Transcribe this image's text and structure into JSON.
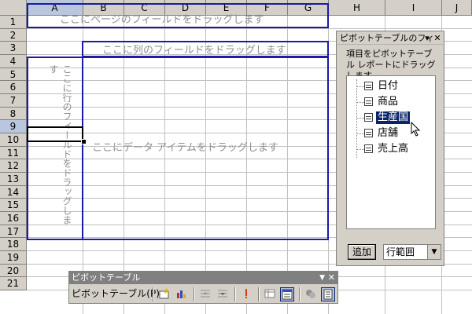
{
  "spreadsheet": {
    "columns": [
      "A",
      "B",
      "C",
      "D",
      "E",
      "F",
      "G",
      "H",
      "I",
      "J"
    ],
    "rows": [
      "1",
      "2",
      "3",
      "4",
      "5",
      "6",
      "7",
      "8",
      "9",
      "10",
      "11",
      "12",
      "13",
      "14",
      "15",
      "16",
      "17",
      "18",
      "19",
      "20",
      "21"
    ],
    "selected_column": "A",
    "selected_row": "9"
  },
  "pivot_regions": {
    "page_drop": "ここにページのフィールドをドラッグします",
    "column_drop": "ここに列のフィールドをドラッグします",
    "row_drop": "ここに行のフィールドをドラッグします",
    "data_drop": "ここにデータ アイテムをドラッグします"
  },
  "field_panel": {
    "title": "ピボットテーブルのフィ",
    "description": "項目をピボットテーブル レポートにドラッグします",
    "fields": [
      {
        "label": "日付"
      },
      {
        "label": "商品"
      },
      {
        "label": "生産国",
        "selected": true
      },
      {
        "label": "店舗"
      },
      {
        "label": "売上高"
      }
    ],
    "add_button": "追加",
    "area_select": "行範囲"
  },
  "pivot_toolbar": {
    "title": "ピボットテーブル",
    "menu_label": "ピボットテーブル(P)",
    "icons": [
      "format-report-icon",
      "chart-wizard-icon",
      "hide-detail-icon",
      "show-detail-icon",
      "refresh-icon",
      "field-settings-icon",
      "field-list-icon",
      "hide-items-icon",
      "show-field-list-icon"
    ]
  },
  "colors": {
    "region_border": "#1b1ba5",
    "selection": "#0a246a",
    "header_bg": "#d4d0c8"
  }
}
